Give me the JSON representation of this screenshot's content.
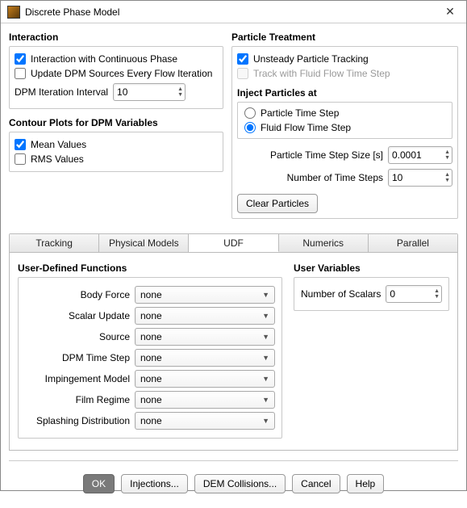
{
  "window": {
    "title": "Discrete Phase Model"
  },
  "interaction": {
    "title": "Interaction",
    "cont_phase_label": "Interaction with Continuous Phase",
    "cont_phase_checked": true,
    "update_every_iter_label": "Update DPM Sources Every Flow Iteration",
    "update_every_iter_checked": false,
    "iter_interval_label": "DPM Iteration Interval",
    "iter_interval_value": "10"
  },
  "contour": {
    "title": "Contour Plots for DPM Variables",
    "mean_label": "Mean Values",
    "mean_checked": true,
    "rms_label": "RMS Values",
    "rms_checked": false
  },
  "treatment": {
    "title": "Particle Treatment",
    "unsteady_label": "Unsteady Particle Tracking",
    "unsteady_checked": true,
    "track_fluid_label": "Track with Fluid Flow Time Step",
    "track_fluid_checked": false,
    "inject_title": "Inject Particles at",
    "radio_particle_label": "Particle Time Step",
    "radio_fluid_label": "Fluid Flow Time Step",
    "radio_selected": "fluid",
    "step_size_label": "Particle Time Step Size [s]",
    "step_size_value": "0.0001",
    "num_steps_label": "Number of Time Steps",
    "num_steps_value": "10",
    "clear_button": "Clear Particles"
  },
  "tabs": {
    "tracking": "Tracking",
    "physical": "Physical Models",
    "udf": "UDF",
    "numerics": "Numerics",
    "parallel": "Parallel",
    "active": "udf"
  },
  "udf": {
    "title": "User-Defined Functions",
    "fields": {
      "body_force": {
        "label": "Body Force",
        "value": "none"
      },
      "scalar_update": {
        "label": "Scalar Update",
        "value": "none"
      },
      "source": {
        "label": "Source",
        "value": "none"
      },
      "dpm_ts": {
        "label": "DPM Time Step",
        "value": "none"
      },
      "impingement": {
        "label": "Impingement Model",
        "value": "none"
      },
      "film_regime": {
        "label": "Film Regime",
        "value": "none"
      },
      "splashing": {
        "label": "Splashing Distribution",
        "value": "none"
      }
    }
  },
  "user_vars": {
    "title": "User Variables",
    "scalars_label": "Number of Scalars",
    "scalars_value": "0"
  },
  "footer": {
    "ok": "OK",
    "injections": "Injections...",
    "dem": "DEM Collisions...",
    "cancel": "Cancel",
    "help": "Help"
  }
}
